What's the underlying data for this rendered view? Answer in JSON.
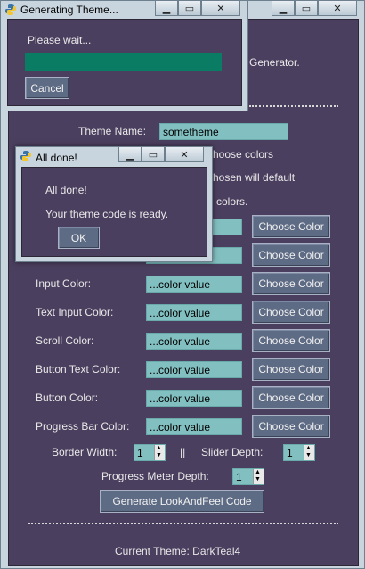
{
  "main": {
    "title_fragment": "Generator.",
    "theme_name_label": "Theme Name:",
    "theme_name_value": "sometheme",
    "instructions_1": "hoose colors",
    "instructions_2": "hosen will default",
    "instructions_3": "colors.",
    "rows": [
      {
        "label": "",
        "value": "",
        "button": "Choose Color"
      },
      {
        "label": "",
        "value": "",
        "button": "Choose Color"
      },
      {
        "label": "Input Color:",
        "value": "...color value",
        "button": "Choose Color"
      },
      {
        "label": "Text Input Color:",
        "value": "...color value",
        "button": "Choose Color"
      },
      {
        "label": "Scroll Color:",
        "value": "...color value",
        "button": "Choose Color"
      },
      {
        "label": "Button Text Color:",
        "value": "...color value",
        "button": "Choose Color"
      },
      {
        "label": "Button Color:",
        "value": "...color value",
        "button": "Choose Color"
      },
      {
        "label": "Progress Bar Color:",
        "value": "...color value",
        "button": "Choose Color"
      }
    ],
    "border_width_label": "Border Width:",
    "border_width_value": "1",
    "separator": "||",
    "slider_depth_label": "Slider Depth:",
    "slider_depth_value": "1",
    "progress_depth_label": "Progress Meter Depth:",
    "progress_depth_value": "1",
    "generate_button": "Generate LookAndFeel Code",
    "current_theme": "Current Theme: DarkTeal4"
  },
  "progress_window": {
    "title": "Generating Theme...",
    "message": "Please wait...",
    "progress_fraction": 1.0,
    "cancel_button": "Cancel"
  },
  "done_window": {
    "title": "All done!",
    "line1": "All done!",
    "line2": "Your theme code is ready.",
    "ok_button": "OK"
  },
  "controls": {
    "minimize_icon": "minimize-icon",
    "maximize_icon": "maximize-icon",
    "close_icon": "close-icon"
  },
  "colors": {
    "background": "#4b3f5f",
    "input": "#82bfc0",
    "button": "#5e6b85",
    "progress_bar": "#0b7c64"
  }
}
